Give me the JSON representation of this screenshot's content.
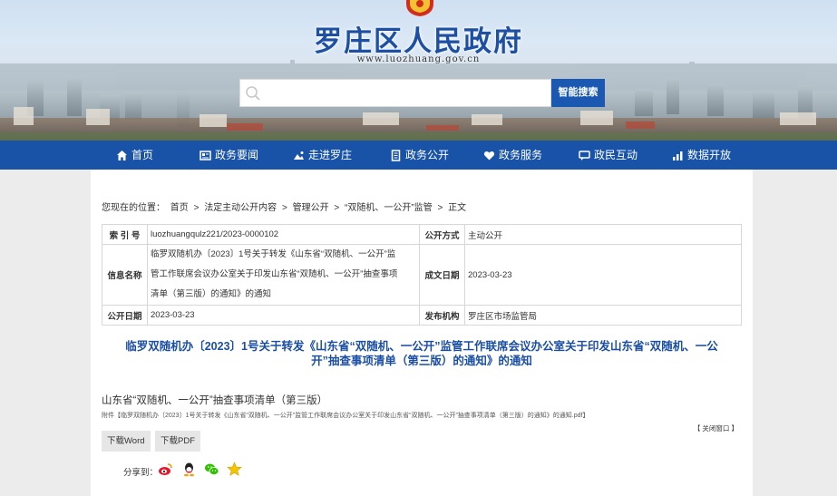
{
  "header": {
    "site_title": "罗庄区人民政府",
    "site_url": "www.luozhuang.gov.cn",
    "search_placeholder": "",
    "search_button": "智能搜索"
  },
  "nav": {
    "items": [
      {
        "label": "首页",
        "icon": "home-icon"
      },
      {
        "label": "政务要闻",
        "icon": "newspaper-icon"
      },
      {
        "label": "走进罗庄",
        "icon": "landscape-icon"
      },
      {
        "label": "政务公开",
        "icon": "document-icon"
      },
      {
        "label": "政务服务",
        "icon": "heart-icon"
      },
      {
        "label": "政民互动",
        "icon": "chat-icon"
      },
      {
        "label": "数据开放",
        "icon": "chart-icon"
      }
    ]
  },
  "breadcrumb": {
    "prefix": "您现在的位置：",
    "items": [
      "首页",
      "法定主动公开内容",
      "管理公开",
      "“双随机、一公开”监管",
      "正文"
    ],
    "separator": ">"
  },
  "meta": {
    "index_label": "索 引 号",
    "index_value": "luozhuangqulz221/2023-0000102",
    "open_mode_label": "公开方式",
    "open_mode_value": "主动公开",
    "info_name_label": "信息名称",
    "info_name_line1": "临罗双随机办〔2023〕1号关于转发《山东省“双随机、一公开”监",
    "info_name_line2": "管工作联席会议办公室关于印发山东省“双随机、一公开”抽查事项",
    "info_name_line3": "清单（第三版）的通知》的通知",
    "created_label": "成文日期",
    "created_value": "2023-03-23",
    "published_label": "公开日期",
    "published_value": "2023-03-23",
    "publisher_label": "发布机构",
    "publisher_value": "罗庄区市场监管局"
  },
  "document": {
    "title_line1": "临罗双随机办〔2023〕1号关于转发《山东省“双随机、一公开”监管工作联席会议办公室关于印发山东省“双随机、一公",
    "title_line2": "开”抽查事项清单（第三版）的通知》的通知",
    "attachment_title": "山东省“双随机、一公开”抽查事项清单（第三版）",
    "attachment_file": "附件【临罗双随机办〔2023〕1号关于转发《山东省“双随机、一公开”监管工作联席会议办公室关于印发山东省“双随机、一公开”抽查事项清单（第三版）的通知》的通知.pdf】",
    "close_window": "【 关闭窗口 】",
    "download_word": "下载Word",
    "download_pdf": "下载PDF",
    "share_label": "分享到："
  },
  "colors": {
    "brand_blue": "#1853a8",
    "title_blue": "#1a4ea3",
    "weibo_red": "#e6162d",
    "wechat_green": "#2dc100",
    "star_yellow": "#f5c400"
  }
}
